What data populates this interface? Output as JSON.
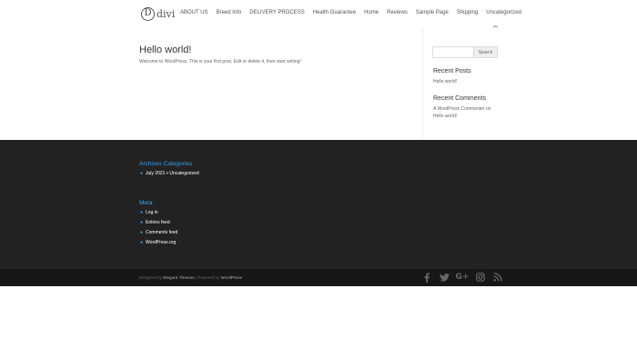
{
  "header": {
    "logo_text": "divi",
    "logo_mark": "D",
    "nav": [
      "ABOUT US",
      "Breed Info",
      "DELIVERY PROCESS",
      "Health Guarantee",
      "Home",
      "Reviews",
      "Sample Page",
      "Shipping",
      "Uncategorized"
    ]
  },
  "post": {
    "title": "Hello world!",
    "body": "Welcome to WordPress. This is your first post. Edit or delete it, then start writing!"
  },
  "sidebar": {
    "search_placeholder": "",
    "search_button": "Search",
    "recent_posts_heading": "Recent Posts",
    "recent_posts": [
      "Hello world!"
    ],
    "recent_comments_heading": "Recent Comments",
    "comment_author": "A WordPress Commenter",
    "comment_on": "on",
    "comment_post": "Hello world!"
  },
  "footer": {
    "archives_heading": "Archives Categories",
    "archives_items": [
      "July 2021",
      "Uncategorized"
    ],
    "meta_heading": "Meta",
    "meta_items": [
      "Log in",
      "Entries feed",
      "Comments feed",
      "WordPress.org"
    ]
  },
  "bottom": {
    "credit_prefix": "Designed by",
    "credit_theme": "Elegant Themes",
    "credit_mid": "| Powered by",
    "credit_wp": "WordPress",
    "social_icons": [
      "facebook-icon",
      "twitter-icon",
      "google-plus-icon",
      "instagram-icon",
      "rss-icon"
    ]
  },
  "colors": {
    "accent": "#2ea3f2",
    "footer_bg": "#222222",
    "bottom_bar_bg": "#171717"
  }
}
